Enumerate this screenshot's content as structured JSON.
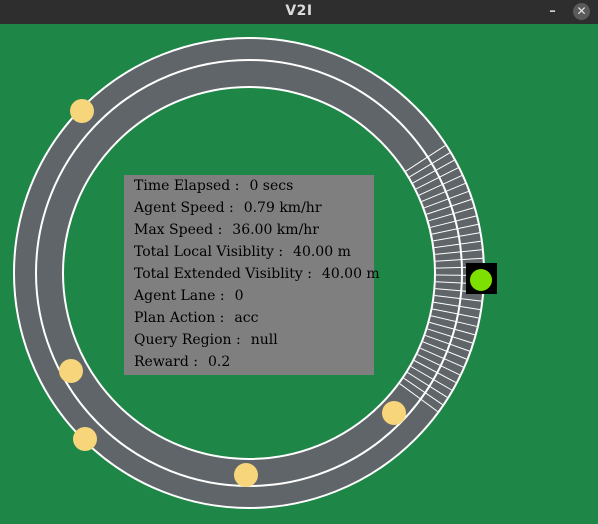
{
  "window": {
    "title": "V2I",
    "minimize_glyph": "–",
    "close_glyph": "✕"
  },
  "colors": {
    "grass": "#1e8647",
    "road": "#5f6568",
    "lane_line": "#ffffff",
    "vehicle": "#f7d57a",
    "agent": "#7ee000",
    "agent_box": "#000000",
    "panel": "#7f7f7f"
  },
  "info": [
    {
      "label": "Time Elapsed :",
      "value": "0 secs"
    },
    {
      "label": "Agent Speed :",
      "value": "0.79 km/hr"
    },
    {
      "label": "Max Speed :",
      "value": "36.00 km/hr"
    },
    {
      "label": "Total Local Visiblity :",
      "value": "40.00 m"
    },
    {
      "label": "Total Extended Visiblity :",
      "value": "40.00 m"
    },
    {
      "label": "Agent Lane :",
      "value": "0"
    },
    {
      "label": "Plan Action :",
      "value": "acc"
    },
    {
      "label": "Query Region :",
      "value": "null"
    },
    {
      "label": "Reward :",
      "value": "0.2"
    }
  ],
  "vehicle_count": 5
}
